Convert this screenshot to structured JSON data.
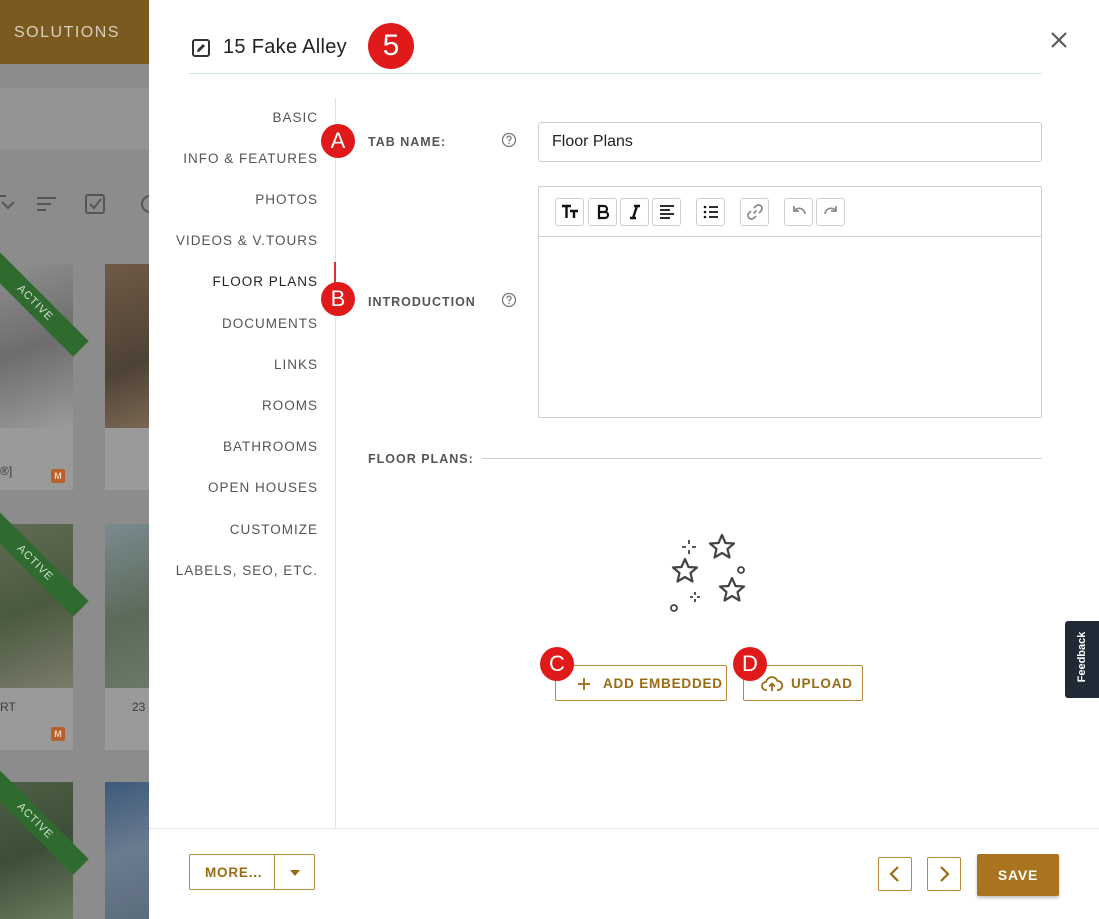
{
  "background": {
    "topbar_label": "SOLUTIONS",
    "ribbon_label": "ACTIVE",
    "card_texts": [
      "®]",
      "RT",
      "23"
    ],
    "badge_label": "M"
  },
  "dialog": {
    "title": "15 Fake Alley",
    "step_marker": "5"
  },
  "nav": {
    "items": [
      {
        "label": "BASIC"
      },
      {
        "label": "INFO & FEATURES"
      },
      {
        "label": "PHOTOS"
      },
      {
        "label": "VIDEOS & V.TOURS"
      },
      {
        "label": "FLOOR PLANS"
      },
      {
        "label": "DOCUMENTS"
      },
      {
        "label": "LINKS"
      },
      {
        "label": "ROOMS"
      },
      {
        "label": "BATHROOMS"
      },
      {
        "label": "OPEN HOUSES"
      },
      {
        "label": "CUSTOMIZE"
      },
      {
        "label": "LABELS, SEO, ETC."
      }
    ],
    "active": "FLOOR PLANS"
  },
  "form": {
    "tab_name_label": "TAB NAME:",
    "tab_name_value": "Floor Plans",
    "introduction_label": "INTRODUCTION",
    "floor_plans_label": "FLOOR PLANS:"
  },
  "markers": {
    "a": "A",
    "b": "B",
    "c": "C",
    "d": "D"
  },
  "actions": {
    "add_embedded": "ADD EMBEDDED",
    "upload": "UPLOAD"
  },
  "footer": {
    "more_label": "MORE...",
    "save_label": "SAVE"
  },
  "feedback_label": "Feedback",
  "colors": {
    "accent": "#a8741e",
    "marker": "#e01a1a",
    "nav_indicator": "#dd3333"
  }
}
